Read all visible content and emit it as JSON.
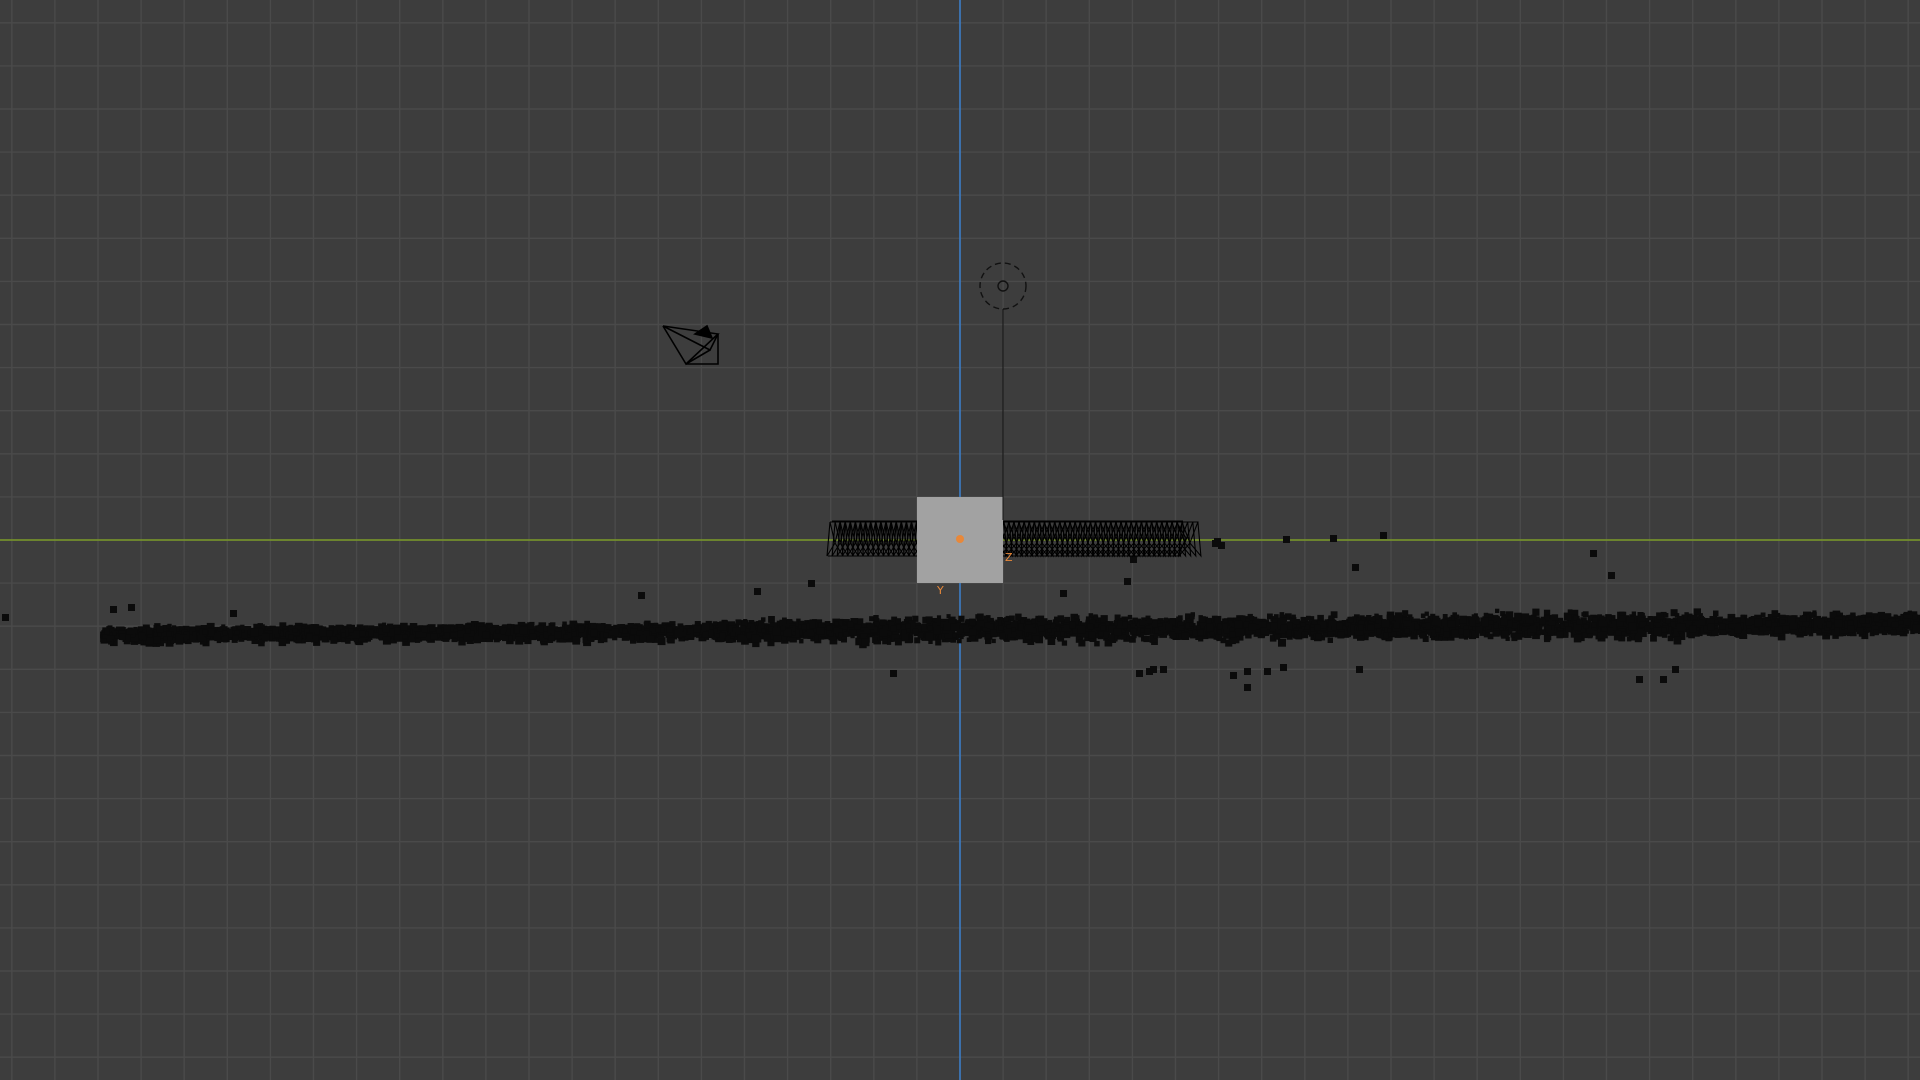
{
  "viewport": {
    "background": "#3d3d3d",
    "grid_minor_color": "#4a4a4a",
    "grid_major_color": "#525252"
  },
  "axes": {
    "x_axis_color": "#7a9a27",
    "z_axis_color": "#3b7dc6",
    "labels": {
      "y": "Y",
      "z": "Z"
    },
    "label_color": "#e8883a"
  },
  "objects": {
    "camera": {
      "name": "camera-icon",
      "wire_color": "#000000"
    },
    "light": {
      "name": "sun-light-icon",
      "wire_color": "#111111"
    },
    "selected_cube": {
      "fill": "#a2a2a2",
      "origin_color": "#e8883a"
    },
    "camera_track": {
      "wire_color": "#000000"
    },
    "point_cloud": {
      "color": "#0b0b0b"
    }
  }
}
